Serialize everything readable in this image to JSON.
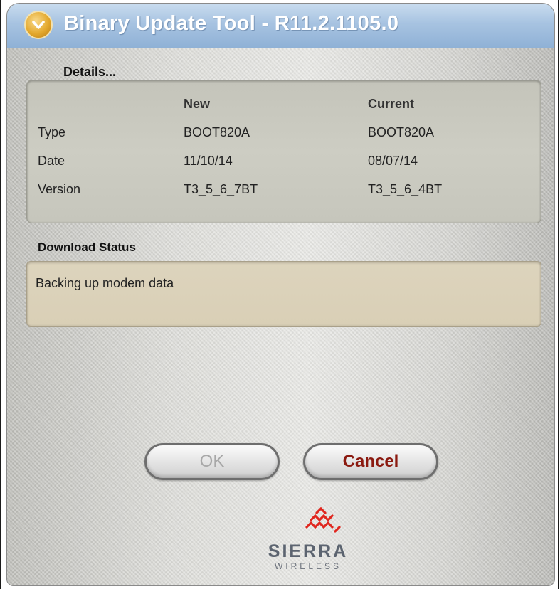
{
  "window": {
    "title": "Binary Update Tool - R11.2.1105.0",
    "accent_color": "#a7c3e1",
    "icon": "download-arrow-icon"
  },
  "details": {
    "heading": "Details...",
    "columns": [
      "New",
      "Current"
    ],
    "rows": [
      {
        "label": "Type",
        "new": "BOOT820A",
        "current": "BOOT820A"
      },
      {
        "label": "Date",
        "new": "11/10/14",
        "current": "08/07/14"
      },
      {
        "label": "Version",
        "new": "T3_5_6_7BT",
        "current": "T3_5_6_4BT"
      }
    ]
  },
  "download_status": {
    "heading": "Download Status",
    "message": "Backing up modem data"
  },
  "buttons": {
    "ok": "OK",
    "cancel": "Cancel"
  },
  "logo": {
    "name": "SIERRA",
    "sub": "WIRELESS",
    "mark_color": "#e0261e"
  }
}
